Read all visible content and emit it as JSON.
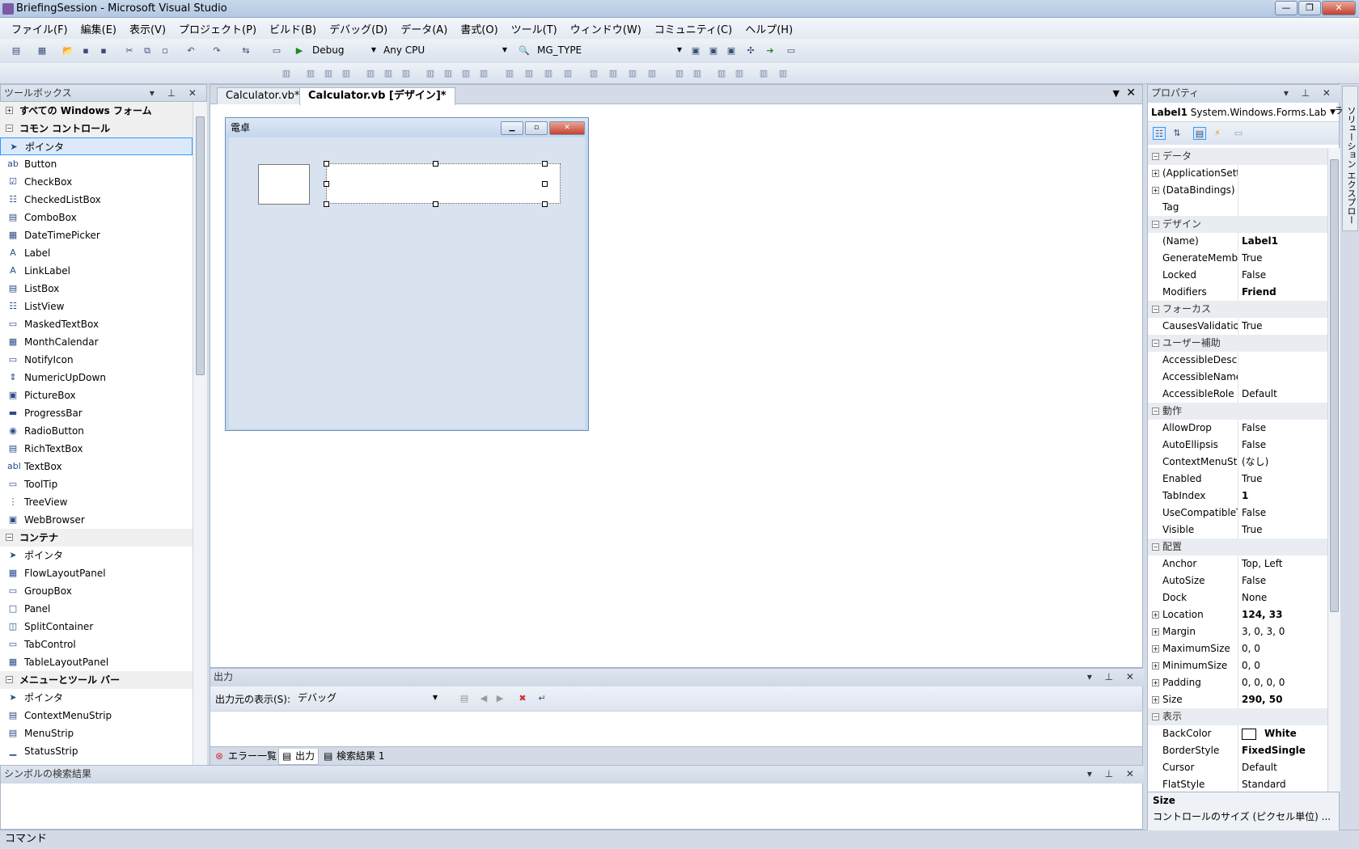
{
  "window": {
    "title": "BriefingSession - Microsoft Visual Studio",
    "minimize": "—",
    "maximize": "❐",
    "close": "✕"
  },
  "menu": [
    "ファイル(F)",
    "編集(E)",
    "表示(V)",
    "プロジェクト(P)",
    "ビルド(B)",
    "デバッグ(D)",
    "データ(A)",
    "書式(O)",
    "ツール(T)",
    "ウィンドウ(W)",
    "コミュニティ(C)",
    "ヘルプ(H)"
  ],
  "toolbar": {
    "config": "Debug",
    "platform": "Any CPU",
    "find_combo": "MG_TYPE"
  },
  "toolbox": {
    "title": "ツールボックス",
    "groups": [
      {
        "label": "すべての Windows フォーム",
        "expanded": false,
        "items": []
      },
      {
        "label": "コモン コントロール",
        "expanded": true,
        "items": [
          "ポインタ",
          "Button",
          "CheckBox",
          "CheckedListBox",
          "ComboBox",
          "DateTimePicker",
          "Label",
          "LinkLabel",
          "ListBox",
          "ListView",
          "MaskedTextBox",
          "MonthCalendar",
          "NotifyIcon",
          "NumericUpDown",
          "PictureBox",
          "ProgressBar",
          "RadioButton",
          "RichTextBox",
          "TextBox",
          "ToolTip",
          "TreeView",
          "WebBrowser"
        ]
      },
      {
        "label": "コンテナ",
        "expanded": true,
        "items": [
          "ポインタ",
          "FlowLayoutPanel",
          "GroupBox",
          "Panel",
          "SplitContainer",
          "TabControl",
          "TableLayoutPanel"
        ]
      },
      {
        "label": "メニューとツール バー",
        "expanded": true,
        "items": [
          "ポインタ",
          "ContextMenuStrip",
          "MenuStrip",
          "StatusStrip"
        ]
      }
    ]
  },
  "document": {
    "tabs": [
      {
        "label": "Calculator.vb*",
        "active": false
      },
      {
        "label": "Calculator.vb [デザイン]*",
        "active": true
      }
    ],
    "form_title": "電卓"
  },
  "output": {
    "title": "出力",
    "source_label": "出力元の表示(S):",
    "source_value": "デバッグ",
    "tabs": [
      "エラー一覧",
      "出力",
      "検索結果 1"
    ]
  },
  "symbol_panel": {
    "title": "シンボルの検索結果"
  },
  "statusbar": {
    "text": "コマンド"
  },
  "properties": {
    "title": "プロパティ",
    "object_name": "Label1",
    "object_type": "System.Windows.Forms.Lab",
    "categories": [
      {
        "label": "データ",
        "rows": [
          {
            "name": "(ApplicationSett",
            "value": "",
            "expand": true
          },
          {
            "name": "(DataBindings)",
            "value": "",
            "expand": true
          },
          {
            "name": "Tag",
            "value": ""
          }
        ]
      },
      {
        "label": "デザイン",
        "rows": [
          {
            "name": "(Name)",
            "value": "Label1",
            "bold": true
          },
          {
            "name": "GenerateMembe",
            "value": "True"
          },
          {
            "name": "Locked",
            "value": "False"
          },
          {
            "name": "Modifiers",
            "value": "Friend",
            "bold": true
          }
        ]
      },
      {
        "label": "フォーカス",
        "rows": [
          {
            "name": "CausesValidatior",
            "value": "True"
          }
        ]
      },
      {
        "label": "ユーザー補助",
        "rows": [
          {
            "name": "AccessibleDescri",
            "value": ""
          },
          {
            "name": "AccessibleName",
            "value": ""
          },
          {
            "name": "AccessibleRole",
            "value": "Default"
          }
        ]
      },
      {
        "label": "動作",
        "rows": [
          {
            "name": "AllowDrop",
            "value": "False"
          },
          {
            "name": "AutoEllipsis",
            "value": "False"
          },
          {
            "name": "ContextMenuStr",
            "value": "(なし)"
          },
          {
            "name": "Enabled",
            "value": "True"
          },
          {
            "name": "TabIndex",
            "value": "1",
            "bold": true
          },
          {
            "name": "UseCompatibleT",
            "value": "False"
          },
          {
            "name": "Visible",
            "value": "True"
          }
        ]
      },
      {
        "label": "配置",
        "rows": [
          {
            "name": "Anchor",
            "value": "Top, Left"
          },
          {
            "name": "AutoSize",
            "value": "False"
          },
          {
            "name": "Dock",
            "value": "None"
          },
          {
            "name": "Location",
            "value": "124, 33",
            "bold": true,
            "expand": true
          },
          {
            "name": "Margin",
            "value": "3, 0, 3, 0",
            "expand": true
          },
          {
            "name": "MaximumSize",
            "value": "0, 0",
            "expand": true
          },
          {
            "name": "MinimumSize",
            "value": "0, 0",
            "expand": true
          },
          {
            "name": "Padding",
            "value": "0, 0, 0, 0",
            "expand": true
          },
          {
            "name": "Size",
            "value": "290, 50",
            "bold": true,
            "expand": true
          }
        ]
      },
      {
        "label": "表示",
        "rows": [
          {
            "name": "BackColor",
            "value": "White",
            "bold": true,
            "swatch": true
          },
          {
            "name": "BorderStyle",
            "value": "FixedSingle",
            "bold": true
          },
          {
            "name": "Cursor",
            "value": "Default"
          },
          {
            "name": "FlatStyle",
            "value": "Standard"
          }
        ]
      }
    ],
    "desc_title": "Size",
    "desc_text": "コントロールのサイズ (ピクセル単位) ..."
  },
  "side_tab": "ソリューション エクスプローラ"
}
